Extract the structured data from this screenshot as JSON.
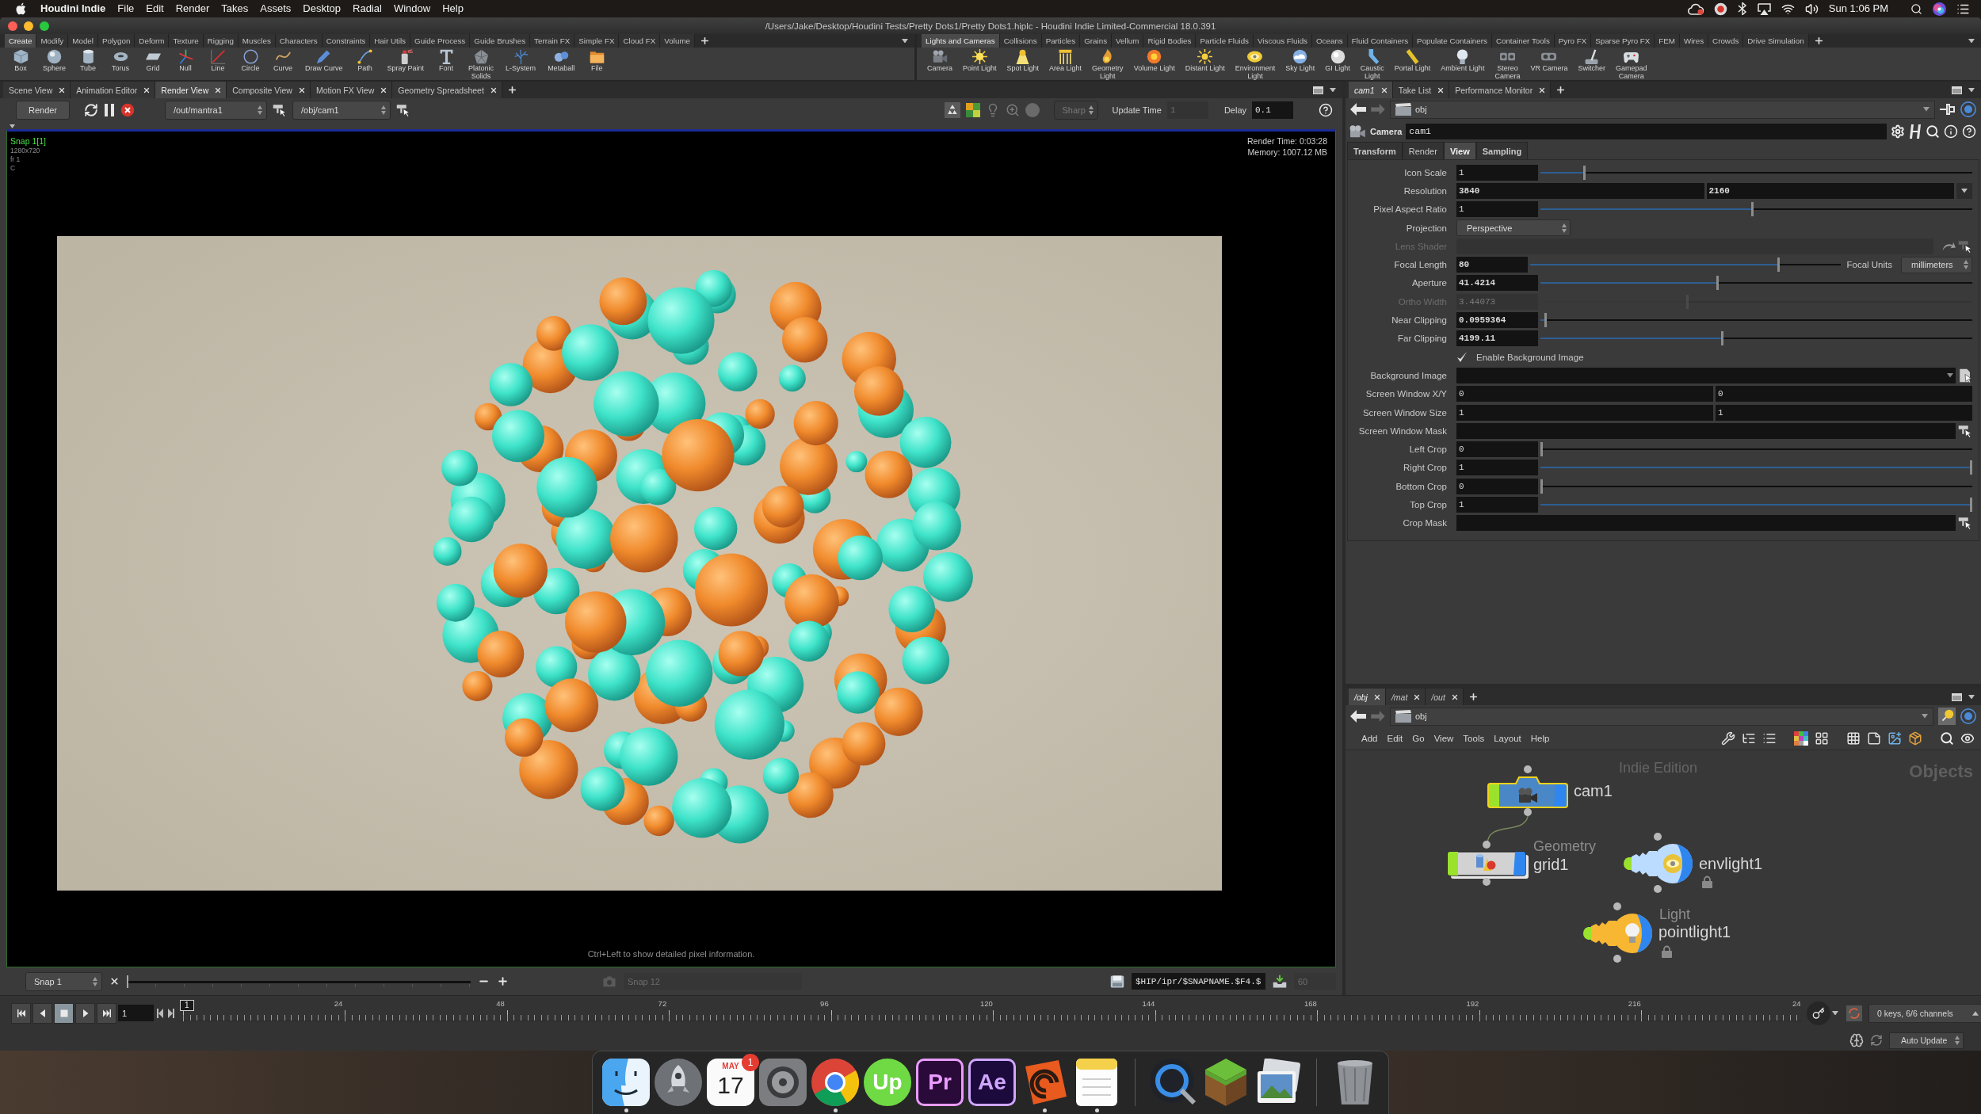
{
  "menubar": {
    "app": "Houdini Indie",
    "items": [
      "File",
      "Edit",
      "Render",
      "Takes",
      "Assets",
      "Desktop",
      "Radial",
      "Window",
      "Help"
    ],
    "clock": "Sun 1:06 PM"
  },
  "window": {
    "title": "/Users/Jake/Desktop/Houdini Tests/Pretty Dots1/Pretty Dots1.hiplc - Houdini Indie Limited-Commercial 18.0.391"
  },
  "shelves": [
    {
      "tabs": [
        {
          "label": "Create",
          "selected": true
        },
        {
          "label": "Modify",
          "selected": false
        },
        {
          "label": "Model",
          "selected": false
        },
        {
          "label": "Polygon",
          "selected": false
        },
        {
          "label": "Deform",
          "selected": false
        },
        {
          "label": "Texture",
          "selected": false
        },
        {
          "label": "Rigging",
          "selected": false
        },
        {
          "label": "Muscles",
          "selected": false
        },
        {
          "label": "Characters",
          "selected": false
        },
        {
          "label": "Constraints",
          "selected": false
        },
        {
          "label": "Hair Utils",
          "selected": false
        },
        {
          "label": "Guide Process",
          "selected": false
        },
        {
          "label": "Guide Brushes",
          "selected": false
        },
        {
          "label": "Terrain FX",
          "selected": false
        },
        {
          "label": "Simple FX",
          "selected": false
        },
        {
          "label": "Cloud FX",
          "selected": false
        },
        {
          "label": "Volume",
          "selected": false
        }
      ],
      "tools": [
        {
          "label": "Box",
          "kind": "box"
        },
        {
          "label": "Sphere",
          "kind": "sphere"
        },
        {
          "label": "Tube",
          "kind": "tube"
        },
        {
          "label": "Torus",
          "kind": "torus"
        },
        {
          "label": "Grid",
          "kind": "grid"
        },
        {
          "label": "Null",
          "kind": "null"
        },
        {
          "label": "Line",
          "kind": "line"
        },
        {
          "label": "Circle",
          "kind": "circle"
        },
        {
          "label": "Curve",
          "kind": "curve"
        },
        {
          "label": "Draw Curve",
          "kind": "drawcurve"
        },
        {
          "label": "Path",
          "kind": "path"
        },
        {
          "label": "Spray Paint",
          "kind": "spray"
        },
        {
          "label": "Font",
          "kind": "font"
        },
        {
          "label": "Platonic Solids",
          "kind": "platonic"
        },
        {
          "label": "L-System",
          "kind": "lsystem"
        },
        {
          "label": "Metaball",
          "kind": "metaball"
        },
        {
          "label": "File",
          "kind": "file"
        }
      ]
    },
    {
      "tabs": [
        {
          "label": "Lights and Cameras",
          "selected": true
        },
        {
          "label": "Collisions",
          "selected": false
        },
        {
          "label": "Particles",
          "selected": false
        },
        {
          "label": "Grains",
          "selected": false
        },
        {
          "label": "Vellum",
          "selected": false
        },
        {
          "label": "Rigid Bodies",
          "selected": false
        },
        {
          "label": "Particle Fluids",
          "selected": false
        },
        {
          "label": "Viscous Fluids",
          "selected": false
        },
        {
          "label": "Oceans",
          "selected": false
        },
        {
          "label": "Fluid Containers",
          "selected": false
        },
        {
          "label": "Populate Containers",
          "selected": false
        },
        {
          "label": "Container Tools",
          "selected": false
        },
        {
          "label": "Pyro FX",
          "selected": false
        },
        {
          "label": "Sparse Pyro FX",
          "selected": false
        },
        {
          "label": "FEM",
          "selected": false
        },
        {
          "label": "Wires",
          "selected": false
        },
        {
          "label": "Crowds",
          "selected": false
        },
        {
          "label": "Drive Simulation",
          "selected": false
        }
      ],
      "tools": [
        {
          "label": "Camera",
          "kind": "camera"
        },
        {
          "label": "Point Light",
          "kind": "pointlight"
        },
        {
          "label": "Spot Light",
          "kind": "spotlight"
        },
        {
          "label": "Area Light",
          "kind": "arealight"
        },
        {
          "label": "Geometry Light",
          "kind": "geolight"
        },
        {
          "label": "Volume Light",
          "kind": "volumelight"
        },
        {
          "label": "Distant Light",
          "kind": "distantlight"
        },
        {
          "label": "Environment Light",
          "kind": "envlight"
        },
        {
          "label": "Sky Light",
          "kind": "skylight"
        },
        {
          "label": "GI Light",
          "kind": "gilight"
        },
        {
          "label": "Caustic Light",
          "kind": "causticlight"
        },
        {
          "label": "Portal Light",
          "kind": "portallight"
        },
        {
          "label": "Ambient Light",
          "kind": "ambientlight"
        },
        {
          "label": "Stereo Camera",
          "kind": "stereocamera"
        },
        {
          "label": "VR Camera",
          "kind": "vrcamera"
        },
        {
          "label": "Switcher",
          "kind": "switcher"
        },
        {
          "label": "Gamepad Camera",
          "kind": "gamepad"
        }
      ]
    }
  ],
  "viewer": {
    "tabs": [
      {
        "label": "Scene View",
        "selected": false
      },
      {
        "label": "Animation Editor",
        "selected": false
      },
      {
        "label": "Render View",
        "selected": true
      },
      {
        "label": "Composite View",
        "selected": false
      },
      {
        "label": "Motion FX View",
        "selected": false
      },
      {
        "label": "Geometry Spreadsheet",
        "selected": false
      }
    ],
    "toolbar": {
      "render": "Render",
      "driver": "/out/mantra1",
      "camera": "/obj/cam1",
      "preview": "Sharp",
      "update_time_label": "Update Time",
      "update_time": "1",
      "delay_label": "Delay",
      "delay": "0.1"
    },
    "overlay": {
      "snapshot": "Snap 1[1]",
      "resolution": "1280x720",
      "frame": "fr 1",
      "plane": "C",
      "render_time": "Render Time: 0:03:28",
      "memory": "Memory: 1007.12 MB",
      "hint": "Ctrl+Left to show detailed pixel information."
    },
    "snapshots": {
      "current": "Snap 1",
      "level": 0,
      "name": "Snap 12",
      "path": "$HIP/ipr/$SNAPNAME.$F4.$",
      "limit": "60"
    }
  },
  "parameters": {
    "pane_tabs": [
      {
        "label": "cam1",
        "selected": true,
        "italic": true
      },
      {
        "label": "Take List",
        "selected": false,
        "italic": false
      },
      {
        "label": "Performance Monitor",
        "selected": false,
        "italic": false
      }
    ],
    "path": "obj",
    "node_type": "Camera",
    "node_name": "cam1",
    "pages": [
      {
        "label": "Transform",
        "selected": false,
        "modified": true
      },
      {
        "label": "Render",
        "selected": false,
        "modified": false
      },
      {
        "label": "View",
        "selected": true,
        "modified": true
      },
      {
        "label": "Sampling",
        "selected": false,
        "modified": true
      }
    ],
    "rows": [
      {
        "kind": "slider",
        "label": "Icon Scale",
        "value": "1",
        "modified": false,
        "disabled": false,
        "level": 0.1
      },
      {
        "kind": "vector",
        "label": "Resolution",
        "values": [
          "3840",
          "2160"
        ],
        "modified": true,
        "disabled": false,
        "menu_button": true
      },
      {
        "kind": "slider",
        "label": "Pixel Aspect Ratio",
        "value": "1",
        "modified": false,
        "disabled": false,
        "level": 0.49
      },
      {
        "kind": "menu",
        "label": "Projection",
        "value": "Perspective",
        "disabled": false
      },
      {
        "kind": "shader",
        "label": "Lens Shader",
        "disabled": true
      },
      {
        "kind": "slider",
        "label": "Focal Length",
        "value": "80",
        "modified": true,
        "disabled": false,
        "level": 0.8,
        "units_label": "Focal Units",
        "units": "millimeters"
      },
      {
        "kind": "slider",
        "label": "Aperture",
        "value": "41.4214",
        "modified": true,
        "disabled": false,
        "level": 0.41
      },
      {
        "kind": "slider",
        "label": "Ortho Width",
        "value": "3.44073",
        "modified": false,
        "disabled": true,
        "level": 0.34
      },
      {
        "kind": "slider",
        "label": "Near Clipping",
        "value": "0.0959364",
        "modified": true,
        "disabled": false,
        "level": 0.01
      },
      {
        "kind": "slider",
        "label": "Far Clipping",
        "value": "4199.11",
        "modified": true,
        "disabled": false,
        "level": 0.42
      },
      {
        "kind": "checkbox",
        "label": "Enable Background Image",
        "checked": true,
        "disabled": false
      },
      {
        "kind": "file",
        "label": "Background Image",
        "disabled": false
      },
      {
        "kind": "vector",
        "label": "Screen Window X/Y",
        "values": [
          "0",
          "0"
        ],
        "modified": false,
        "disabled": false,
        "menu_button": false
      },
      {
        "kind": "vector",
        "label": "Screen Window Size",
        "values": [
          "1",
          "1"
        ],
        "modified": false,
        "disabled": false,
        "menu_button": false
      },
      {
        "kind": "node_path",
        "label": "Screen Window Mask",
        "disabled": false
      },
      {
        "kind": "slider",
        "label": "Left Crop",
        "value": "0",
        "modified": false,
        "disabled": false,
        "level": 0
      },
      {
        "kind": "slider",
        "label": "Right Crop",
        "value": "1",
        "modified": false,
        "disabled": false,
        "level": 1
      },
      {
        "kind": "slider",
        "label": "Bottom Crop",
        "value": "0",
        "modified": false,
        "disabled": false,
        "level": 0
      },
      {
        "kind": "slider",
        "label": "Top Crop",
        "value": "1",
        "modified": false,
        "disabled": false,
        "level": 1
      },
      {
        "kind": "node_path",
        "label": "Crop Mask",
        "disabled": false
      }
    ]
  },
  "network": {
    "tabs": [
      {
        "label": "/obj",
        "selected": true,
        "italic": true
      },
      {
        "label": "/mat",
        "selected": false,
        "italic": true
      },
      {
        "label": "/out",
        "selected": false,
        "italic": true
      }
    ],
    "path": "obj",
    "menu": [
      "Add",
      "Edit",
      "Go",
      "View",
      "Tools",
      "Layout",
      "Help"
    ],
    "edition": "Indie Edition",
    "context": "Objects",
    "nodes": [
      {
        "kind": "camera",
        "name": "cam1",
        "selected": true,
        "locked": false
      },
      {
        "kind": "geometry",
        "type_label": "Geometry",
        "name": "grid1",
        "selected": false,
        "locked": false
      },
      {
        "kind": "envlight",
        "name": "envlight1",
        "selected": false,
        "locked": true
      },
      {
        "kind": "pointlight",
        "type_label": "Light",
        "name": "pointlight1",
        "selected": false,
        "locked": true
      }
    ]
  },
  "timeline": {
    "transport": [
      {
        "kind": "start",
        "selected": false
      },
      {
        "kind": "back",
        "selected": false
      },
      {
        "kind": "stop",
        "selected": true
      },
      {
        "kind": "play",
        "selected": false
      },
      {
        "kind": "end",
        "selected": false
      }
    ],
    "frame": "1",
    "marker": "1",
    "ticks": [
      "24",
      "48",
      "72",
      "96",
      "120",
      "144",
      "168",
      "192",
      "216",
      "24"
    ],
    "keys": "0 keys, 6/6 channels",
    "update": "Auto Update"
  },
  "dock": {
    "sections": [
      {
        "items": [
          {
            "kind": "finder",
            "running": true
          },
          {
            "kind": "launchpad",
            "running": false
          },
          {
            "kind": "calendar",
            "month": "MAY",
            "label": "17",
            "badge": "1",
            "running": false
          },
          {
            "kind": "settings",
            "running": false
          },
          {
            "kind": "chrome",
            "running": true
          },
          {
            "kind": "upwork",
            "label": "Up",
            "running": false
          },
          {
            "kind": "premiere",
            "label": "Pr",
            "running": false
          },
          {
            "kind": "aftereffects",
            "label": "Ae",
            "running": false
          },
          {
            "kind": "houdini",
            "running": true
          },
          {
            "kind": "notes",
            "running": true
          }
        ]
      },
      {
        "items": [
          {
            "kind": "lensring",
            "running": false
          },
          {
            "kind": "minecraft",
            "running": false
          },
          {
            "kind": "preview",
            "running": false
          }
        ]
      },
      {
        "items": [
          {
            "kind": "trash",
            "running": false
          }
        ]
      }
    ]
  }
}
